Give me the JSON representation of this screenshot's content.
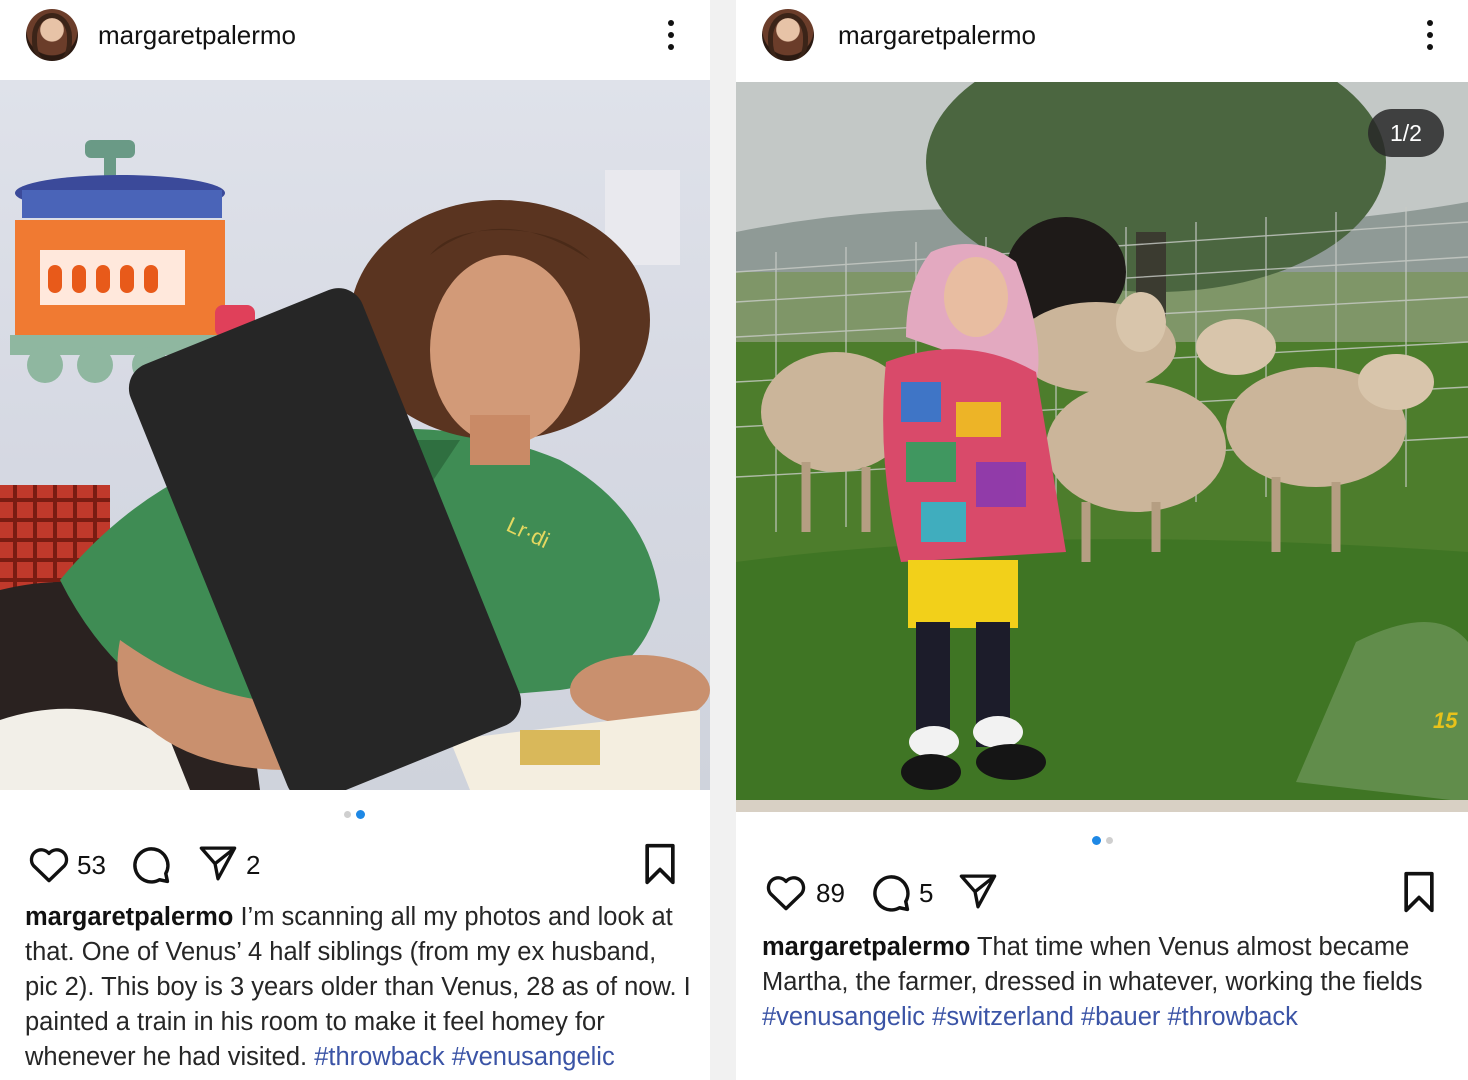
{
  "posts": [
    {
      "username": "margaretpalermo",
      "carousel": {
        "total": 2,
        "active": 2
      },
      "likes": "53",
      "shares": "2",
      "caption_text": "I’m scanning all my photos and look at that. One of Venus’ 4 half siblings (from my ex husband, pic 2). This boy is 3 years older than Venus, 28 as of now. I painted a train in his room to make it feel homey for whenever he had visited.",
      "hashtags": [
        "#throwback",
        "#venusangelic"
      ]
    },
    {
      "username": "margaretpalermo",
      "carousel": {
        "total": 2,
        "active": 1,
        "counter": "1/2"
      },
      "likes": "89",
      "comments": "5",
      "photo_stamp": "15",
      "caption_text": "That time when Venus almost became Martha, the farmer, dressed in whatever, working the fields",
      "hashtags": [
        "#venusangelic",
        "#switzerland",
        "#bauer",
        "#throwback"
      ]
    }
  ],
  "icons": {
    "more": "more-vertical-icon",
    "like": "heart-icon",
    "comment": "comment-bubble-icon",
    "share": "paper-plane-icon",
    "save": "bookmark-icon"
  },
  "colors": {
    "hashtag": "#3b54a6",
    "active_dot": "#1e88e5",
    "inactive_dot": "#cfcfcf",
    "redaction": "#262626"
  }
}
